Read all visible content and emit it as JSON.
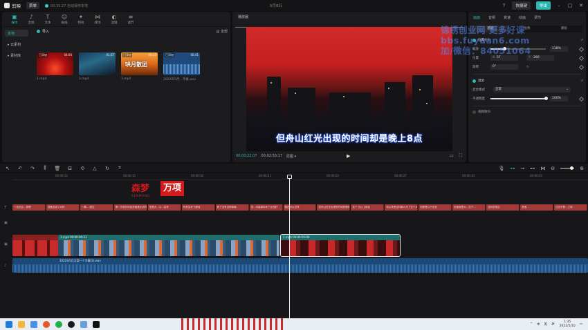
{
  "titlebar": {
    "app_name": "剪映",
    "menu_label": "菜单",
    "save_status": "00:35:27 自动保存本地",
    "project_name": "5月8日",
    "shortcut_label": "快捷键",
    "export_label": "导出"
  },
  "toolbar_tabs": [
    {
      "label": "媒体",
      "icon": "▣"
    },
    {
      "label": "音频",
      "icon": "♪"
    },
    {
      "label": "文本",
      "icon": "T"
    },
    {
      "label": "贴纸",
      "icon": "☺"
    },
    {
      "label": "特效",
      "icon": "✦"
    },
    {
      "label": "转场",
      "icon": "⋈"
    },
    {
      "label": "滤镜",
      "icon": "◐"
    },
    {
      "label": "调节",
      "icon": "≡"
    }
  ],
  "side_nav": [
    {
      "label": "本地"
    },
    {
      "label": "▸ 云素材"
    },
    {
      "label": "▸ 素材库"
    }
  ],
  "media": {
    "import_label": "导入",
    "sort_label": "▤ 全部",
    "items": [
      {
        "added": "已添加",
        "duration": "04:00",
        "name": "1.mp4",
        "thumb": "red"
      },
      {
        "added": "",
        "duration": "01:37",
        "name": "2.mp4",
        "thumb": "blue"
      },
      {
        "added": "已添加",
        "duration": "00:13",
        "name": "3.mp4",
        "thumb": "sunset",
        "overlay": "哄月散团"
      },
      {
        "added": "已添加",
        "duration": "00:41",
        "name": "2022年5月…字幕.wav",
        "thumb": "wave"
      }
    ]
  },
  "player": {
    "title": "播放器",
    "subtitle": "但舟山红光出现的时间却是晚上8点",
    "timecode_current": "00:00:22:07",
    "timecode_total": "00:02:50:17",
    "quality_label": "原图 ▾",
    "play_icon": "▶"
  },
  "right_panel": {
    "tabs": [
      "画面",
      "音频",
      "变速",
      "动画",
      "调节"
    ],
    "sub_tabs": [
      "基础",
      "抠像",
      "蒙版"
    ],
    "section_position": "位置大小",
    "scale_label": "缩放",
    "scale_value": "118%",
    "scale_fraction": 0.25,
    "position_label": "位置",
    "pos_x_label": "X",
    "pos_x": "57",
    "pos_y_label": "Y",
    "pos_y": "-266",
    "rotate_label": "旋转",
    "rotate_value": "0°",
    "section_blend": "混合",
    "blend_mode_label": "混合模式",
    "blend_mode_value": "正常",
    "opacity_label": "不透明度",
    "opacity_value": "100%",
    "opacity_fraction": 1.0,
    "section_stabilize": "视频防抖"
  },
  "watermark": {
    "line1": "锦绣创业网 更多好课",
    "line2": "bbs.fuyuan6.com",
    "line3": "加/微信：84051064"
  },
  "timeline": {
    "ruler_labels": [
      "00:00:12",
      "00:00:15",
      "00:00:18",
      "00:00:21",
      "00:00:24",
      "00:00:27",
      "00:00:30",
      "00:00:33"
    ],
    "text_clips": [
      "一战无比…原理",
      "准备这成了月球",
      "一颗… 越过",
      "第一次和月球自然相遇大战时",
      "但是大…以…后来",
      "有机会来下越地",
      "即了没有这种事情",
      "但…可能事年年了比较好",
      "就在可以这样",
      "但舟山红光出现的时间却是晚上8点",
      "这个 位以上就会",
      "你从来是这样那么关了这个大约",
      "但那是以下也多",
      "前面就是大…这个…",
      "这种说现出",
      "其他…",
      "这也不是…之间"
    ],
    "video_clips": [
      {
        "name": "3.mp4",
        "duration": "00:00:09:23"
      },
      {
        "name": "1.mp4",
        "duration": "00:00:05:00"
      }
    ],
    "audio_clip": "2022年5月文案一个字幕(2).wav",
    "logo_main": "森梦",
    "logo_box": "万项",
    "logo_sub": "SENMENG"
  },
  "taskbar": {
    "time": "1:35",
    "date": "2022/5/10",
    "lang": "中",
    "lang2": "英"
  }
}
